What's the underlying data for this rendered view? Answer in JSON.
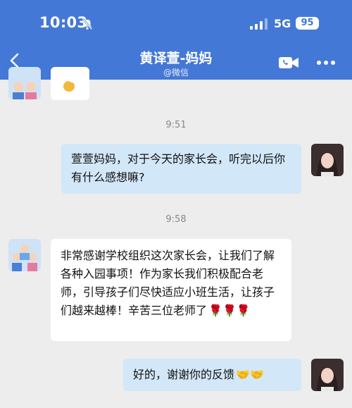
{
  "status_bar": {
    "time": "10:03",
    "network": "5G",
    "battery": "95"
  },
  "header": {
    "title": "黄译萱-妈妈",
    "subtitle": "@微信"
  },
  "messages": [
    {
      "timestamp": "9:51",
      "text": "萱萱妈妈，对于今天的家长会，听完以后你有什么感想嘛?"
    },
    {
      "timestamp": "9:58",
      "text": "非常感谢学校组织这次家长会，让我们了解各种入园事项！作为家长我们积极配合老师，引导孩子们尽快适应小班生活，让孩子们越来越棒！辛苦三位老师了",
      "emoji": "🌹🌹🌹"
    },
    {
      "text": "好的，谢谢你的反馈",
      "emoji": "🤝🤝"
    }
  ],
  "icons": [
    "back-arrow-icon",
    "video-call-icon",
    "more-icon",
    "mute-bell-icon",
    "signal-icon"
  ],
  "colors": {
    "header": "#4378d6",
    "sent_bubble": "#d2e7f8",
    "received_bubble": "#ffffff",
    "background": "#ededed"
  }
}
